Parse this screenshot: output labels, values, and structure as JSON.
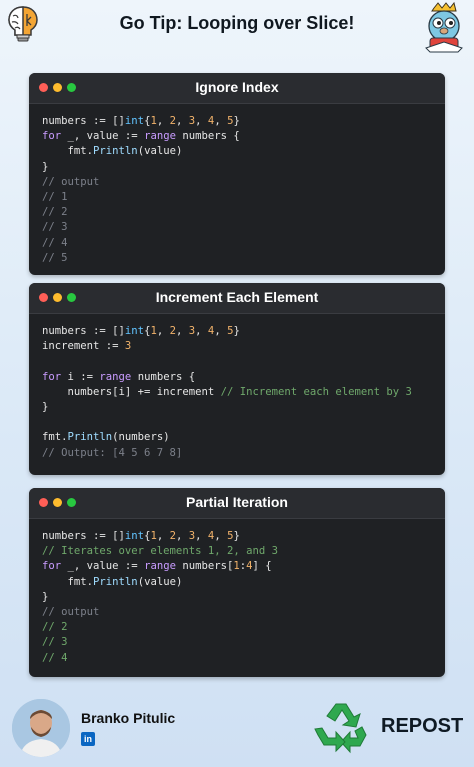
{
  "header": {
    "title": "Go Tip: Looping over Slice!"
  },
  "cards": [
    {
      "title": "Ignore Index",
      "lines": [
        [
          {
            "c": "t-plain",
            "t": "numbers := []"
          },
          {
            "c": "t-type",
            "t": "int"
          },
          {
            "c": "t-plain",
            "t": "{"
          },
          {
            "c": "t-num",
            "t": "1"
          },
          {
            "c": "t-plain",
            "t": ", "
          },
          {
            "c": "t-num",
            "t": "2"
          },
          {
            "c": "t-plain",
            "t": ", "
          },
          {
            "c": "t-num",
            "t": "3"
          },
          {
            "c": "t-plain",
            "t": ", "
          },
          {
            "c": "t-num",
            "t": "4"
          },
          {
            "c": "t-plain",
            "t": ", "
          },
          {
            "c": "t-num",
            "t": "5"
          },
          {
            "c": "t-plain",
            "t": "}"
          }
        ],
        [
          {
            "c": "t-kw",
            "t": "for"
          },
          {
            "c": "t-plain",
            "t": " _, value := "
          },
          {
            "c": "t-kw",
            "t": "range"
          },
          {
            "c": "t-plain",
            "t": " numbers {"
          }
        ],
        [
          {
            "c": "t-plain",
            "t": "    fmt."
          },
          {
            "c": "t-fn",
            "t": "Println"
          },
          {
            "c": "t-plain",
            "t": "(value)"
          }
        ],
        [
          {
            "c": "t-plain",
            "t": "}"
          }
        ],
        [
          {
            "c": "t-comment",
            "t": "// output"
          }
        ],
        [
          {
            "c": "t-comment",
            "t": "// 1"
          }
        ],
        [
          {
            "c": "t-comment",
            "t": "// 2"
          }
        ],
        [
          {
            "c": "t-comment",
            "t": "// 3"
          }
        ],
        [
          {
            "c": "t-comment",
            "t": "// 4"
          }
        ],
        [
          {
            "c": "t-comment",
            "t": "// 5"
          }
        ]
      ]
    },
    {
      "title": "Increment Each Element",
      "lines": [
        [
          {
            "c": "t-plain",
            "t": "numbers := []"
          },
          {
            "c": "t-type",
            "t": "int"
          },
          {
            "c": "t-plain",
            "t": "{"
          },
          {
            "c": "t-num",
            "t": "1"
          },
          {
            "c": "t-plain",
            "t": ", "
          },
          {
            "c": "t-num",
            "t": "2"
          },
          {
            "c": "t-plain",
            "t": ", "
          },
          {
            "c": "t-num",
            "t": "3"
          },
          {
            "c": "t-plain",
            "t": ", "
          },
          {
            "c": "t-num",
            "t": "4"
          },
          {
            "c": "t-plain",
            "t": ", "
          },
          {
            "c": "t-num",
            "t": "5"
          },
          {
            "c": "t-plain",
            "t": "}"
          }
        ],
        [
          {
            "c": "t-plain",
            "t": "increment := "
          },
          {
            "c": "t-num",
            "t": "3"
          }
        ],
        [],
        [
          {
            "c": "t-kw",
            "t": "for"
          },
          {
            "c": "t-plain",
            "t": " i := "
          },
          {
            "c": "t-kw",
            "t": "range"
          },
          {
            "c": "t-plain",
            "t": " numbers {"
          }
        ],
        [
          {
            "c": "t-plain",
            "t": "    numbers[i] += increment "
          },
          {
            "c": "t-inline-comment",
            "t": "// Increment each element by 3"
          }
        ],
        [
          {
            "c": "t-plain",
            "t": "}"
          }
        ],
        [],
        [
          {
            "c": "t-plain",
            "t": "fmt."
          },
          {
            "c": "t-fn",
            "t": "Println"
          },
          {
            "c": "t-plain",
            "t": "(numbers)"
          }
        ],
        [
          {
            "c": "t-comment",
            "t": "// Output: [4 5 6 7 8]"
          }
        ]
      ]
    },
    {
      "title": "Partial Iteration",
      "lines": [
        [
          {
            "c": "t-plain",
            "t": "numbers := []"
          },
          {
            "c": "t-type",
            "t": "int"
          },
          {
            "c": "t-plain",
            "t": "{"
          },
          {
            "c": "t-num",
            "t": "1"
          },
          {
            "c": "t-plain",
            "t": ", "
          },
          {
            "c": "t-num",
            "t": "2"
          },
          {
            "c": "t-plain",
            "t": ", "
          },
          {
            "c": "t-num",
            "t": "3"
          },
          {
            "c": "t-plain",
            "t": ", "
          },
          {
            "c": "t-num",
            "t": "4"
          },
          {
            "c": "t-plain",
            "t": ", "
          },
          {
            "c": "t-num",
            "t": "5"
          },
          {
            "c": "t-plain",
            "t": "}"
          }
        ],
        [
          {
            "c": "t-inline-comment",
            "t": "// Iterates over elements 1, 2, and 3"
          }
        ],
        [
          {
            "c": "t-kw",
            "t": "for"
          },
          {
            "c": "t-plain",
            "t": " _, value := "
          },
          {
            "c": "t-kw",
            "t": "range"
          },
          {
            "c": "t-plain",
            "t": " numbers["
          },
          {
            "c": "t-num",
            "t": "1"
          },
          {
            "c": "t-plain",
            "t": ":"
          },
          {
            "c": "t-num",
            "t": "4"
          },
          {
            "c": "t-plain",
            "t": "] {"
          }
        ],
        [
          {
            "c": "t-plain",
            "t": "    fmt."
          },
          {
            "c": "t-fn",
            "t": "Println"
          },
          {
            "c": "t-plain",
            "t": "(value)"
          }
        ],
        [
          {
            "c": "t-plain",
            "t": "}"
          }
        ],
        [
          {
            "c": "t-comment",
            "t": "// output"
          }
        ],
        [
          {
            "c": "t-inline-comment",
            "t": "// 2"
          }
        ],
        [
          {
            "c": "t-inline-comment",
            "t": "// 3"
          }
        ],
        [
          {
            "c": "t-inline-comment",
            "t": "// 4"
          }
        ]
      ]
    }
  ],
  "footer": {
    "author_name": "Branko Pitulic",
    "linkedin_icon_text": "in",
    "repost_label": "REPOST"
  },
  "colors": {
    "card_bg": "#1f2124",
    "card_header_bg": "#2a2c30",
    "keyword": "#c99cff",
    "type": "#62c4ff",
    "number": "#f2b36b",
    "comment": "#7c808a",
    "inline_comment": "#6fa86b",
    "recycle_green": "#2fa84f"
  },
  "icons": {
    "left_logo": "brain-lightbulb-icon",
    "right_logo": "gopher-mascot-icon",
    "linkedin": "linkedin-icon",
    "repost": "recycle-icon"
  }
}
